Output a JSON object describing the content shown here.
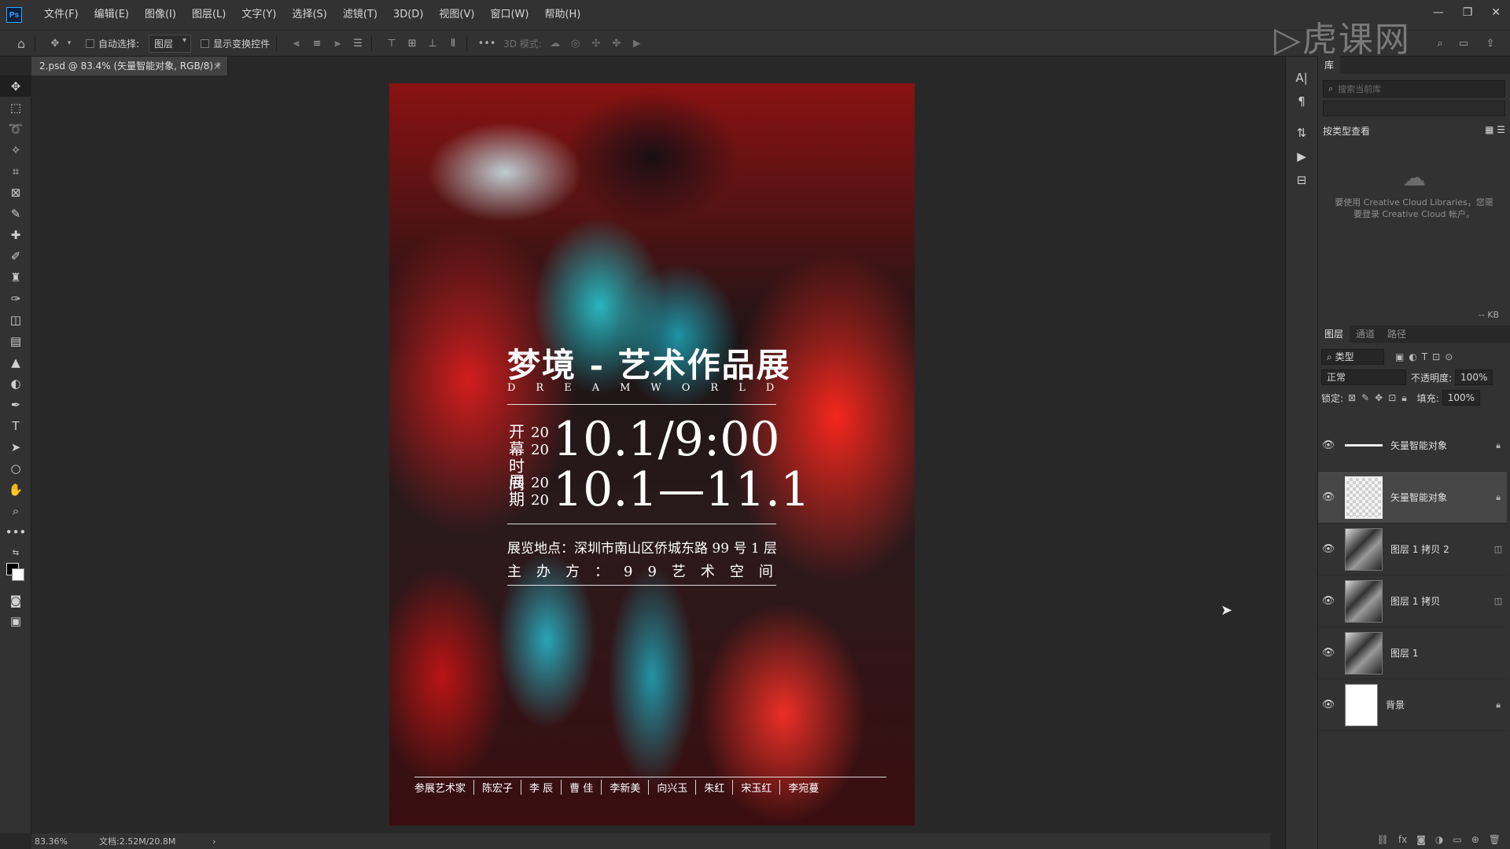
{
  "app": {
    "logo": "Ps"
  },
  "menu": [
    "文件(F)",
    "编辑(E)",
    "图像(I)",
    "图层(L)",
    "文字(Y)",
    "选择(S)",
    "滤镜(T)",
    "3D(D)",
    "视图(V)",
    "窗口(W)",
    "帮助(H)"
  ],
  "options": {
    "auto_select_label": "自动选择:",
    "auto_select_value": "图层",
    "show_transform_label": "显示变换控件",
    "three_d_mode_label": "3D 模式:"
  },
  "document_tab": {
    "title": "2.psd @ 83.4% (矢量智能对象, RGB/8) *",
    "close": "×"
  },
  "poster": {
    "title": "梦境 - 艺术作品展",
    "subtitle": "DREAMWORLD",
    "open_label": "开幕时间",
    "year_top": "20",
    "year_bottom": "20",
    "open_time": "10.1/9:00",
    "period_label": "展期",
    "period": "10.1—11.1",
    "address": "展览地点：深圳市南山区侨城东路 99 号 1 层",
    "host": "主办方：99艺术空间",
    "artists": [
      "参展艺术家",
      "陈宏子",
      "李 辰",
      "曹 佳",
      "李新美",
      "向兴玉",
      "朱红",
      "宋玉红",
      "李宛蔓"
    ]
  },
  "status": {
    "zoom": "83.36%",
    "doc": "文档:2.52M/20.8M",
    "arrow": "›"
  },
  "libraries": {
    "tab": "库",
    "search_placeholder": "搜索当前库",
    "view_by": "按类型查看",
    "message": "要使用 Creative Cloud Libraries，您需要登录 Creative Cloud 帐户。",
    "kb": "-- KB"
  },
  "layers_panel": {
    "tabs": [
      "图层",
      "通道",
      "路径"
    ],
    "filter": "类型",
    "blend_mode": "正常",
    "opacity_label": "不透明度:",
    "opacity_value": "100%",
    "lock_label": "锁定:",
    "fill_label": "填充:",
    "fill_value": "100%",
    "layers": [
      {
        "name": "矢量智能对象",
        "thumb": "line"
      },
      {
        "name": "矢量智能对象",
        "thumb": "transparent"
      },
      {
        "name": "图层 1 拷贝 2",
        "thumb": "image"
      },
      {
        "name": "图层 1 拷贝",
        "thumb": "image"
      },
      {
        "name": "图层 1",
        "thumb": "image"
      },
      {
        "name": "背景",
        "thumb": "white"
      }
    ]
  }
}
